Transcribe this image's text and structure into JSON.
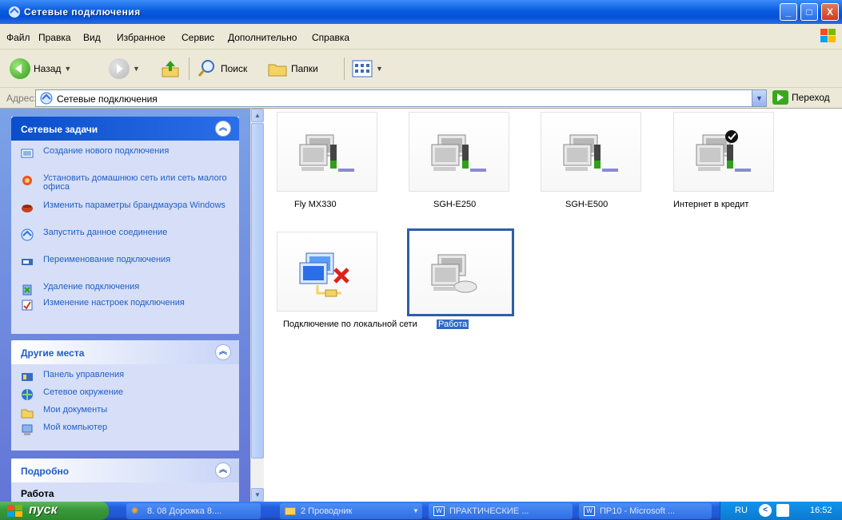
{
  "window": {
    "title": "Сетевые подключения",
    "controls": {
      "minimize": "_",
      "maximize": "□",
      "close": "X"
    }
  },
  "menu": [
    "Файл",
    "Правка",
    "Вид",
    "Избранное",
    "Сервис",
    "Дополнительно",
    "Справка"
  ],
  "toolbar": {
    "back": "Назад",
    "search": "Поиск",
    "folders": "Папки"
  },
  "address": {
    "label": "Адрес:",
    "value": "Сетевые подключения",
    "go": "Переход"
  },
  "taskpane": {
    "network_tasks": {
      "title": "Сетевые задачи",
      "items": [
        {
          "label": "Создание нового подключения",
          "icon": "new-connection-icon"
        },
        {
          "label": "Установить домашнюю сеть или сеть малого офиса",
          "icon": "home-network-icon"
        },
        {
          "label": "Изменить параметры брандмауэра Windows",
          "icon": "firewall-icon"
        },
        {
          "label": "Запустить данное соединение",
          "icon": "connect-icon"
        },
        {
          "label": "Переименование подключения",
          "icon": "rename-icon"
        },
        {
          "label": "Удаление подключения",
          "icon": "delete-icon"
        },
        {
          "label": "Изменение настроек подключения",
          "icon": "settings-icon"
        }
      ]
    },
    "other_places": {
      "title": "Другие места",
      "items": [
        {
          "label": "Панель управления",
          "icon": "control-panel-icon"
        },
        {
          "label": "Сетевое окружение",
          "icon": "network-places-icon"
        },
        {
          "label": "Мои документы",
          "icon": "my-documents-icon"
        },
        {
          "label": "Мой компьютер",
          "icon": "my-computer-icon"
        }
      ]
    },
    "details": {
      "title": "Подробно",
      "name": "Работа"
    }
  },
  "connections": [
    {
      "label": "Fly MX330",
      "type": "dialup"
    },
    {
      "label": "SGH-E250",
      "type": "dialup"
    },
    {
      "label": "SGH-E500",
      "type": "dialup"
    },
    {
      "label": "Интернет в кредит",
      "type": "dialup-default"
    },
    {
      "label": "Подключение по локальной сети",
      "type": "lan-disconnected"
    },
    {
      "label": "Работа",
      "type": "vpn",
      "selected": true
    }
  ],
  "taskbar": {
    "start": "пуск",
    "buttons": [
      "8. 08 Дорожка 8....",
      "2 Проводник",
      "ПРАКТИЧЕСКИЕ ...",
      "ПР10 - Microsoft ..."
    ],
    "language": "RU",
    "clock": "16:52"
  }
}
